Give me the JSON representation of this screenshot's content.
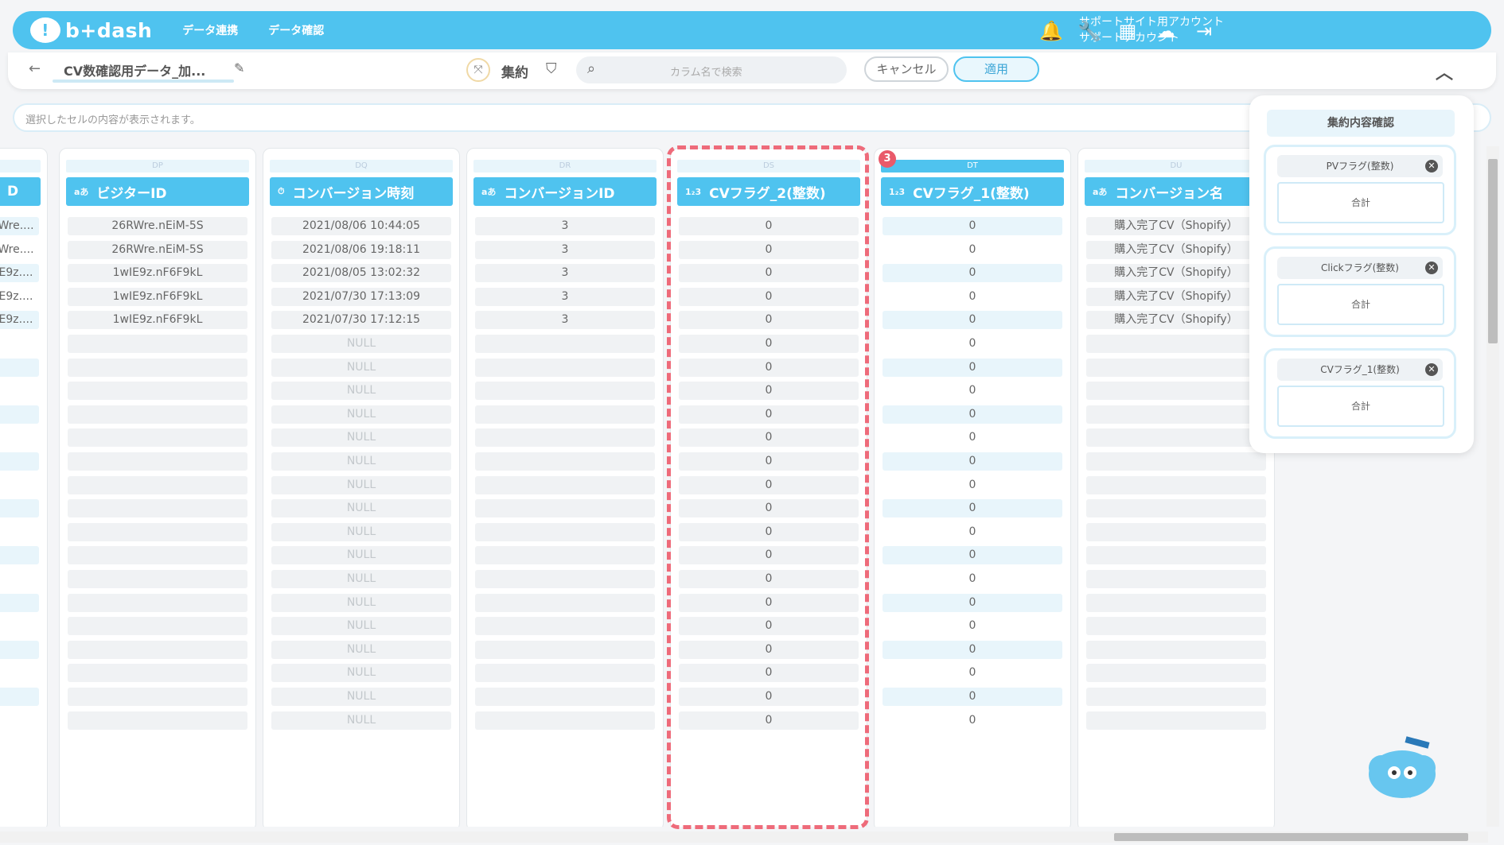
{
  "brand": {
    "logo_text": "b+dash"
  },
  "nav": {
    "link1": "データ連携",
    "link2": "データ確認"
  },
  "account": {
    "line1": "サポートサイト用アカウント",
    "line2": "サポートアカウント"
  },
  "icons": {
    "bell": "bell-icon",
    "wrench": "wrench-icon",
    "grid": "apps-grid-icon",
    "cloud": "support-cloud-icon",
    "logout": "logout-icon"
  },
  "subbar": {
    "title": "CV数確認用データ_加...",
    "aggregate_label": "集約",
    "search_placeholder": "カラム名で検索",
    "cancel_label": "キャンセル",
    "apply_label": "適用"
  },
  "preview": {
    "placeholder": "選択したセルの内容が表示されます。"
  },
  "columns": [
    {
      "letter": "",
      "type": "",
      "name": "D",
      "values": [
        "Wre....",
        "Wre....",
        "E9z....",
        "E9z....",
        "E9z...."
      ]
    },
    {
      "letter": "DP",
      "type": "aあ",
      "name": "ビジターID",
      "values": [
        "26RWre.nEiM-5S",
        "26RWre.nEiM-5S",
        "1wIE9z.nF6F9kL",
        "1wIE9z.nF6F9kL",
        "1wIE9z.nF6F9kL"
      ]
    },
    {
      "letter": "DQ",
      "type": "⏱",
      "name": "コンバージョン時刻",
      "values": [
        "2021/08/06 10:44:05",
        "2021/08/06 19:18:11",
        "2021/08/05 13:02:32",
        "2021/07/30 17:13:09",
        "2021/07/30 17:12:15"
      ],
      "null_label": "NULL"
    },
    {
      "letter": "DR",
      "type": "aあ",
      "name": "コンバージョンID",
      "values": [
        "3",
        "3",
        "3",
        "3",
        "3"
      ]
    },
    {
      "letter": "DS",
      "type": "1₂3",
      "name": "CVフラグ_2(整数)",
      "values": [
        "0"
      ]
    },
    {
      "letter": "DT",
      "type": "1₂3",
      "name": "CVフラグ_1(整数)",
      "values": [
        "0"
      ]
    },
    {
      "letter": "DU",
      "type": "aあ",
      "name": "コンバージョン名",
      "values": [
        "購入完了CV（Shopify）",
        "購入完了CV（Shopify）",
        "購入完了CV（Shopify）",
        "購入完了CV（Shopify）",
        "購入完了CV（Shopify）"
      ]
    }
  ],
  "badge": "3",
  "panel": {
    "title": "集約内容確認",
    "cards": [
      {
        "header": "PVフラグ(整数)",
        "body": "合計"
      },
      {
        "header": "Clickフラグ(整数)",
        "body": "合計"
      },
      {
        "header": "CVフラグ_1(整数)",
        "body": "合計"
      }
    ]
  },
  "colors": {
    "accent": "#4fc3ef",
    "highlight_dash": "#ee6b7a",
    "badge": "#e95a6a"
  }
}
